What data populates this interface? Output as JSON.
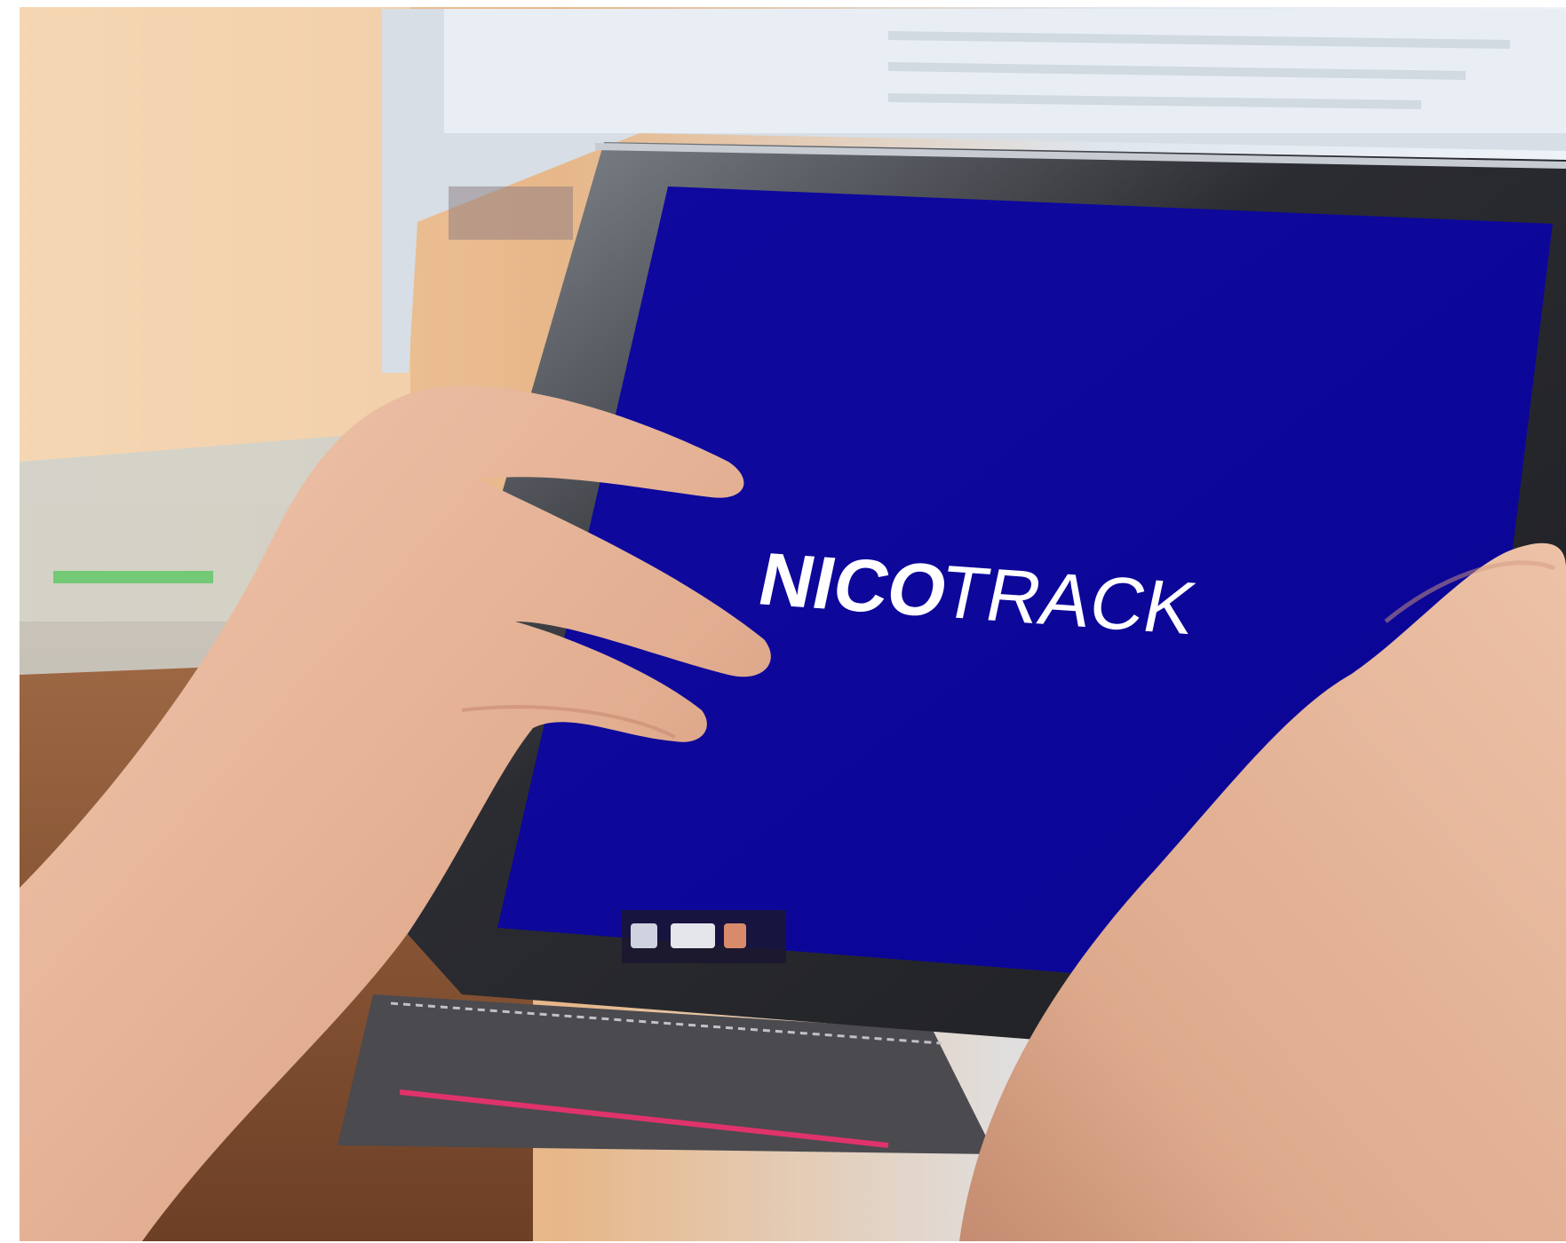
{
  "screen": {
    "logo_bold": "NICO",
    "logo_light": "TRACK"
  },
  "colors": {
    "screen_blue": "#0d08a3",
    "wall_warm": "#e9b98c",
    "desk_wood": "#8a5a3a",
    "skin": "#e6b59a",
    "bezel": "#2a2a2e",
    "laptop_silver": "#cfd6dc"
  },
  "icons": [
    "dock-icon-a",
    "dock-icon-b",
    "dock-icon-c"
  ]
}
